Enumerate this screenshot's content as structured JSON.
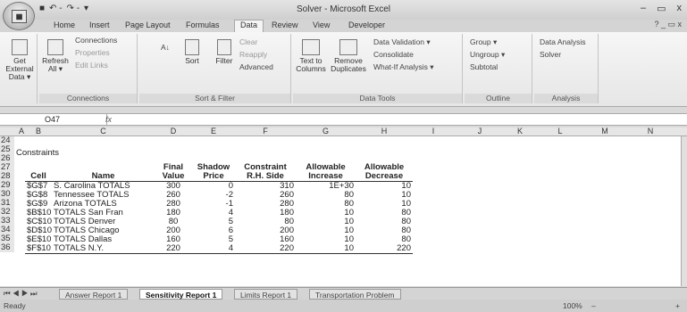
{
  "window": {
    "title": "Solver - Microsoft Excel",
    "office_button": "Office",
    "min": "–",
    "max": "▭",
    "close": "x",
    "qat_save": "■",
    "qat_undo": "↶ -",
    "qat_redo": "↷ -",
    "qat_customize": "▾"
  },
  "tabs": {
    "items": [
      "Home",
      "Insert",
      "Page Layout",
      "Formulas",
      "Data",
      "Review",
      "View",
      "Developer"
    ],
    "right_controls": "? _ ▭ x"
  },
  "ribbon": {
    "get_external_data": "Get External Data ▾",
    "refresh_all": "Refresh All ▾",
    "connections": "Connections",
    "properties": "Properties",
    "edit_links": "Edit Links",
    "sort_asc": "A↓",
    "sort": "Sort",
    "filter": "Filter",
    "clear": "Clear",
    "reapply": "Reapply",
    "advanced": "Advanced",
    "text_to_columns": "Text to Columns",
    "remove_duplicates": "Remove Duplicates",
    "data_validation": "Data Validation ▾",
    "consolidate": "Consolidate",
    "what_if": "What-If Analysis ▾",
    "group": "Group ▾",
    "ungroup": "Ungroup ▾",
    "subtotal": "Subtotal",
    "data_analysis": "Data Analysis",
    "solver": "Solver",
    "group_labels": {
      "connections": "Connections",
      "sort_filter": "Sort & Filter",
      "data_tools": "Data Tools",
      "outline": "Outline",
      "analysis": "Analysis"
    }
  },
  "formula_bar": {
    "cell_ref": "O47",
    "fx": "fx",
    "value": ""
  },
  "columns": [
    "A",
    "B",
    "C",
    "D",
    "E",
    "F",
    "G",
    "H",
    "I",
    "J",
    "K",
    "L",
    "M",
    "N"
  ],
  "rows": [
    "24",
    "25",
    "26",
    "27",
    "28",
    "29",
    "30",
    "31",
    "32",
    "33",
    "34",
    "35",
    "36"
  ],
  "section_title": "Constraints",
  "table": {
    "headers_top": [
      "",
      "",
      "Final",
      "Shadow",
      "Constraint",
      "Allowable",
      "Allowable"
    ],
    "headers": [
      "Cell",
      "Name",
      "Value",
      "Price",
      "R.H. Side",
      "Increase",
      "Decrease"
    ],
    "rows": [
      [
        "$G$7",
        "S. Carolina TOTALS",
        "300",
        "0",
        "310",
        "1E+30",
        "10"
      ],
      [
        "$G$8",
        "Tennessee TOTALS",
        "260",
        "-2",
        "260",
        "80",
        "10"
      ],
      [
        "$G$9",
        "Arizona TOTALS",
        "280",
        "-1",
        "280",
        "80",
        "10"
      ],
      [
        "$B$10",
        "TOTALS San Fran",
        "180",
        "4",
        "180",
        "10",
        "80"
      ],
      [
        "$C$10",
        "TOTALS Denver",
        "80",
        "5",
        "80",
        "10",
        "80"
      ],
      [
        "$D$10",
        "TOTALS Chicago",
        "200",
        "6",
        "200",
        "10",
        "80"
      ],
      [
        "$E$10",
        "TOTALS Dallas",
        "160",
        "5",
        "160",
        "10",
        "80"
      ],
      [
        "$F$10",
        "TOTALS N.Y.",
        "220",
        "4",
        "220",
        "10",
        "220"
      ]
    ]
  },
  "sheet_tabs": [
    "Answer Report 1",
    "Sensitivity Report 1",
    "Limits Report 1",
    "Transportation Problem"
  ],
  "sheet_nav": "⏮ ◀ ▶ ⏭",
  "status": {
    "ready": "Ready",
    "zoom": "100%",
    "zoom_minus": "–",
    "zoom_plus": "+"
  }
}
